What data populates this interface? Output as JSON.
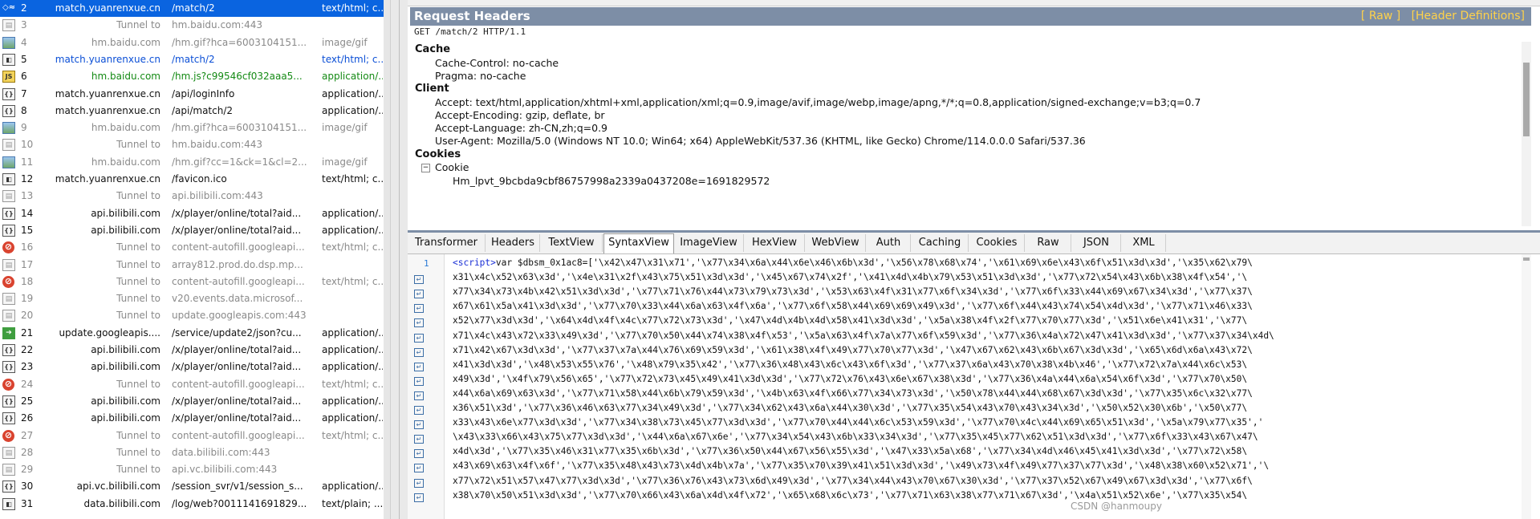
{
  "sessions": [
    {
      "num": "2",
      "host": "match.yuanrenxue.cn",
      "url": "/match/2",
      "type": "text/html; c...",
      "icon": "selected-arrows-icon",
      "style": "selected"
    },
    {
      "num": "3",
      "host": "Tunnel to",
      "url": "hm.baidu.com:443",
      "type": "",
      "icon": "tunnel-icon",
      "style": "tunnel"
    },
    {
      "num": "4",
      "host": "hm.baidu.com",
      "url": "/hm.gif?hca=6003104151...",
      "type": "image/gif",
      "icon": "image-icon",
      "style": "tunnel"
    },
    {
      "num": "5",
      "host": "match.yuanrenxue.cn",
      "url": "/match/2",
      "type": "text/html; c...",
      "icon": "html-icon",
      "style": "blue"
    },
    {
      "num": "6",
      "host": "hm.baidu.com",
      "url": "/hm.js?c99546cf032aaa5...",
      "type": "application/...",
      "icon": "js-icon",
      "style": "green"
    },
    {
      "num": "7",
      "host": "match.yuanrenxue.cn",
      "url": "/api/loginInfo",
      "type": "application/...",
      "icon": "json-icon",
      "style": "plain"
    },
    {
      "num": "8",
      "host": "match.yuanrenxue.cn",
      "url": "/api/match/2",
      "type": "application/...",
      "icon": "json-icon",
      "style": "plain"
    },
    {
      "num": "9",
      "host": "hm.baidu.com",
      "url": "/hm.gif?hca=6003104151...",
      "type": "image/gif",
      "icon": "image-icon",
      "style": "tunnel"
    },
    {
      "num": "10",
      "host": "Tunnel to",
      "url": "hm.baidu.com:443",
      "type": "",
      "icon": "tunnel-icon",
      "style": "tunnel"
    },
    {
      "num": "11",
      "host": "hm.baidu.com",
      "url": "/hm.gif?cc=1&ck=1&cl=2...",
      "type": "image/gif",
      "icon": "image-icon",
      "style": "tunnel"
    },
    {
      "num": "12",
      "host": "match.yuanrenxue.cn",
      "url": "/favicon.ico",
      "type": "text/html; c...",
      "icon": "html-icon",
      "style": "plain"
    },
    {
      "num": "13",
      "host": "Tunnel to",
      "url": "api.bilibili.com:443",
      "type": "",
      "icon": "tunnel-icon",
      "style": "tunnel"
    },
    {
      "num": "14",
      "host": "api.bilibili.com",
      "url": "/x/player/online/total?aid...",
      "type": "application/...",
      "icon": "json-icon",
      "style": "plain"
    },
    {
      "num": "15",
      "host": "api.bilibili.com",
      "url": "/x/player/online/total?aid...",
      "type": "application/...",
      "icon": "json-icon",
      "style": "plain"
    },
    {
      "num": "16",
      "host": "Tunnel to",
      "url": "content-autofill.googleapi...",
      "type": "text/html; c...",
      "icon": "blocked-icon",
      "style": "tunnel"
    },
    {
      "num": "17",
      "host": "Tunnel to",
      "url": "array812.prod.do.dsp.mp...",
      "type": "",
      "icon": "tunnel-icon",
      "style": "tunnel"
    },
    {
      "num": "18",
      "host": "Tunnel to",
      "url": "content-autofill.googleapi...",
      "type": "text/html; c...",
      "icon": "blocked-icon",
      "style": "tunnel"
    },
    {
      "num": "19",
      "host": "Tunnel to",
      "url": "v20.events.data.microsof...",
      "type": "",
      "icon": "tunnel-icon",
      "style": "tunnel"
    },
    {
      "num": "20",
      "host": "Tunnel to",
      "url": "update.googleapis.com:443",
      "type": "",
      "icon": "tunnel-icon",
      "style": "tunnel"
    },
    {
      "num": "21",
      "host": "update.googleapis....",
      "url": "/service/update2/json?cu...",
      "type": "application/...",
      "icon": "arrow-icon",
      "style": "plain"
    },
    {
      "num": "22",
      "host": "api.bilibili.com",
      "url": "/x/player/online/total?aid...",
      "type": "application/...",
      "icon": "json-icon",
      "style": "plain"
    },
    {
      "num": "23",
      "host": "api.bilibili.com",
      "url": "/x/player/online/total?aid...",
      "type": "application/...",
      "icon": "json-icon",
      "style": "plain"
    },
    {
      "num": "24",
      "host": "Tunnel to",
      "url": "content-autofill.googleapi...",
      "type": "text/html; c...",
      "icon": "blocked-icon",
      "style": "tunnel"
    },
    {
      "num": "25",
      "host": "api.bilibili.com",
      "url": "/x/player/online/total?aid...",
      "type": "application/...",
      "icon": "json-icon",
      "style": "plain"
    },
    {
      "num": "26",
      "host": "api.bilibili.com",
      "url": "/x/player/online/total?aid...",
      "type": "application/...",
      "icon": "json-icon",
      "style": "plain"
    },
    {
      "num": "27",
      "host": "Tunnel to",
      "url": "content-autofill.googleapi...",
      "type": "text/html; c...",
      "icon": "blocked-icon",
      "style": "tunnel"
    },
    {
      "num": "28",
      "host": "Tunnel to",
      "url": "data.bilibili.com:443",
      "type": "",
      "icon": "tunnel-icon",
      "style": "tunnel"
    },
    {
      "num": "29",
      "host": "Tunnel to",
      "url": "api.vc.bilibili.com:443",
      "type": "",
      "icon": "tunnel-icon",
      "style": "tunnel"
    },
    {
      "num": "30",
      "host": "api.vc.bilibili.com",
      "url": "/session_svr/v1/session_s...",
      "type": "application/...",
      "icon": "json-icon",
      "style": "plain"
    },
    {
      "num": "31",
      "host": "data.bilibili.com",
      "url": "/log/web?0011141691829...",
      "type": "text/plain; ...",
      "icon": "html-icon",
      "style": "plain"
    }
  ],
  "request_headers": {
    "title": "Request Headers",
    "raw_link": "[ Raw ]",
    "defs_link": "[Header Definitions]",
    "request_line": "GET /match/2 HTTP/1.1",
    "groups": {
      "cache": "Cache",
      "client": "Client",
      "cookies": "Cookies"
    },
    "cache_control": "Cache-Control: no-cache",
    "pragma": "Pragma: no-cache",
    "accept": "Accept: text/html,application/xhtml+xml,application/xml;q=0.9,image/avif,image/webp,image/apng,*/*;q=0.8,application/signed-exchange;v=b3;q=0.7",
    "accept_encoding": "Accept-Encoding: gzip, deflate, br",
    "accept_language": "Accept-Language: zh-CN,zh;q=0.9",
    "user_agent": "User-Agent: Mozilla/5.0 (Windows NT 10.0; Win64; x64) AppleWebKit/537.36 (KHTML, like Gecko) Chrome/114.0.0.0 Safari/537.36",
    "cookie_label": "Cookie",
    "cookie_value": "Hm_lpvt_9bcbda9cbf86757998a2339a0437208e=1691829572"
  },
  "response_tabs": [
    "Transformer",
    "Headers",
    "TextView",
    "SyntaxView",
    "ImageView",
    "HexView",
    "WebView",
    "Auth",
    "Caching",
    "Cookies",
    "Raw",
    "JSON",
    "XML"
  ],
  "active_tab": "SyntaxView",
  "code": {
    "line_number": "1",
    "tag_open": "<script>",
    "lines": [
      "var $dbsm_0x1ac8=['\\x42\\x47\\x31\\x71','\\x77\\x34\\x6a\\x44\\x6e\\x46\\x6b\\x3d','\\x56\\x78\\x68\\x74','\\x61\\x69\\x6e\\x43\\x6f\\x51\\x3d\\x3d','\\x35\\x62\\x79\\",
      "x31\\x4c\\x52\\x63\\x3d','\\x4e\\x31\\x2f\\x43\\x75\\x51\\x3d\\x3d','\\x45\\x67\\x74\\x2f','\\x41\\x4d\\x4b\\x79\\x53\\x51\\x3d\\x3d','\\x77\\x72\\x54\\x43\\x6b\\x38\\x4f\\x54','\\",
      "x77\\x34\\x73\\x4b\\x42\\x51\\x3d\\x3d','\\x77\\x71\\x76\\x44\\x73\\x79\\x73\\x3d','\\x53\\x63\\x4f\\x31\\x77\\x6f\\x34\\x3d','\\x77\\x6f\\x33\\x44\\x69\\x67\\x34\\x3d','\\x77\\x37\\",
      "x67\\x61\\x5a\\x41\\x3d\\x3d','\\x77\\x70\\x33\\x44\\x6a\\x63\\x4f\\x6a','\\x77\\x6f\\x58\\x44\\x69\\x69\\x49\\x3d','\\x77\\x6f\\x44\\x43\\x74\\x54\\x4d\\x3d','\\x77\\x71\\x46\\x33\\",
      "x52\\x77\\x3d\\x3d','\\x64\\x4d\\x4f\\x4c\\x77\\x72\\x73\\x3d','\\x47\\x4d\\x4b\\x4d\\x58\\x41\\x3d\\x3d','\\x5a\\x38\\x4f\\x2f\\x77\\x70\\x77\\x3d','\\x51\\x6e\\x41\\x31','\\x77\\",
      "x71\\x4c\\x43\\x72\\x33\\x49\\x3d','\\x77\\x70\\x50\\x44\\x74\\x38\\x4f\\x53','\\x5a\\x63\\x4f\\x7a\\x77\\x6f\\x59\\x3d','\\x77\\x36\\x4a\\x72\\x47\\x41\\x3d\\x3d','\\x77\\x37\\x34\\x4d\\",
      "x71\\x42\\x67\\x3d\\x3d','\\x77\\x37\\x7a\\x44\\x76\\x69\\x59\\x3d','\\x61\\x38\\x4f\\x49\\x77\\x70\\x77\\x3d','\\x47\\x67\\x62\\x43\\x6b\\x67\\x3d\\x3d','\\x65\\x6d\\x6a\\x43\\x72\\",
      "x41\\x3d\\x3d','\\x48\\x53\\x55\\x76','\\x48\\x79\\x35\\x42','\\x77\\x36\\x48\\x43\\x6c\\x43\\x6f\\x3d','\\x77\\x37\\x6a\\x43\\x70\\x38\\x4b\\x46','\\x77\\x72\\x7a\\x44\\x6c\\x53\\",
      "x49\\x3d','\\x4f\\x79\\x56\\x65','\\x77\\x72\\x73\\x45\\x49\\x41\\x3d\\x3d','\\x77\\x72\\x76\\x43\\x6e\\x67\\x38\\x3d','\\x77\\x36\\x4a\\x44\\x6a\\x54\\x6f\\x3d','\\x77\\x70\\x50\\",
      "x44\\x6a\\x69\\x63\\x3d','\\x77\\x71\\x58\\x44\\x6b\\x79\\x59\\x3d','\\x4b\\x63\\x4f\\x66\\x77\\x34\\x73\\x3d','\\x50\\x78\\x44\\x44\\x68\\x67\\x3d\\x3d','\\x77\\x35\\x6c\\x32\\x77\\",
      "x36\\x51\\x3d','\\x77\\x36\\x46\\x63\\x77\\x34\\x49\\x3d','\\x77\\x34\\x62\\x43\\x6a\\x44\\x30\\x3d','\\x77\\x35\\x54\\x43\\x70\\x43\\x34\\x3d','\\x50\\x52\\x30\\x6b','\\x50\\x77\\",
      "x33\\x43\\x6e\\x77\\x3d\\x3d','\\x77\\x34\\x38\\x73\\x45\\x77\\x3d\\x3d','\\x77\\x70\\x44\\x44\\x6c\\x53\\x59\\x3d','\\x77\\x70\\x4c\\x44\\x69\\x65\\x51\\x3d','\\x5a\\x79\\x77\\x35','",
      "\\x43\\x33\\x66\\x43\\x75\\x77\\x3d\\x3d','\\x44\\x6a\\x67\\x6e','\\x77\\x34\\x54\\x43\\x6b\\x33\\x34\\x3d','\\x77\\x35\\x45\\x77\\x62\\x51\\x3d\\x3d','\\x77\\x6f\\x33\\x43\\x67\\x47\\",
      "x4d\\x3d','\\x77\\x35\\x46\\x31\\x77\\x35\\x6b\\x3d','\\x77\\x36\\x50\\x44\\x67\\x56\\x55\\x3d','\\x47\\x33\\x5a\\x68','\\x77\\x34\\x4d\\x46\\x45\\x41\\x3d\\x3d','\\x77\\x72\\x58\\",
      "x43\\x69\\x63\\x4f\\x6f','\\x77\\x35\\x48\\x43\\x73\\x4d\\x4b\\x7a','\\x77\\x35\\x70\\x39\\x41\\x51\\x3d\\x3d','\\x49\\x73\\x4f\\x49\\x77\\x37\\x77\\x3d','\\x48\\x38\\x60\\x52\\x71','\\",
      "x77\\x72\\x51\\x57\\x47\\x77\\x3d\\x3d','\\x77\\x36\\x76\\x43\\x73\\x6d\\x49\\x3d','\\x77\\x34\\x44\\x43\\x70\\x67\\x30\\x3d','\\x77\\x37\\x52\\x67\\x49\\x67\\x3d\\x3d','\\x77\\x6f\\",
      "x38\\x70\\x50\\x51\\x3d\\x3d','\\x77\\x70\\x66\\x43\\x6a\\x4d\\x4f\\x72','\\x65\\x68\\x6c\\x73','\\x77\\x71\\x63\\x38\\x77\\x71\\x67\\x3d','\\x4a\\x51\\x52\\x6e','\\x77\\x35\\x54\\"
    ]
  },
  "watermark": "CSDN @hanmoupy"
}
